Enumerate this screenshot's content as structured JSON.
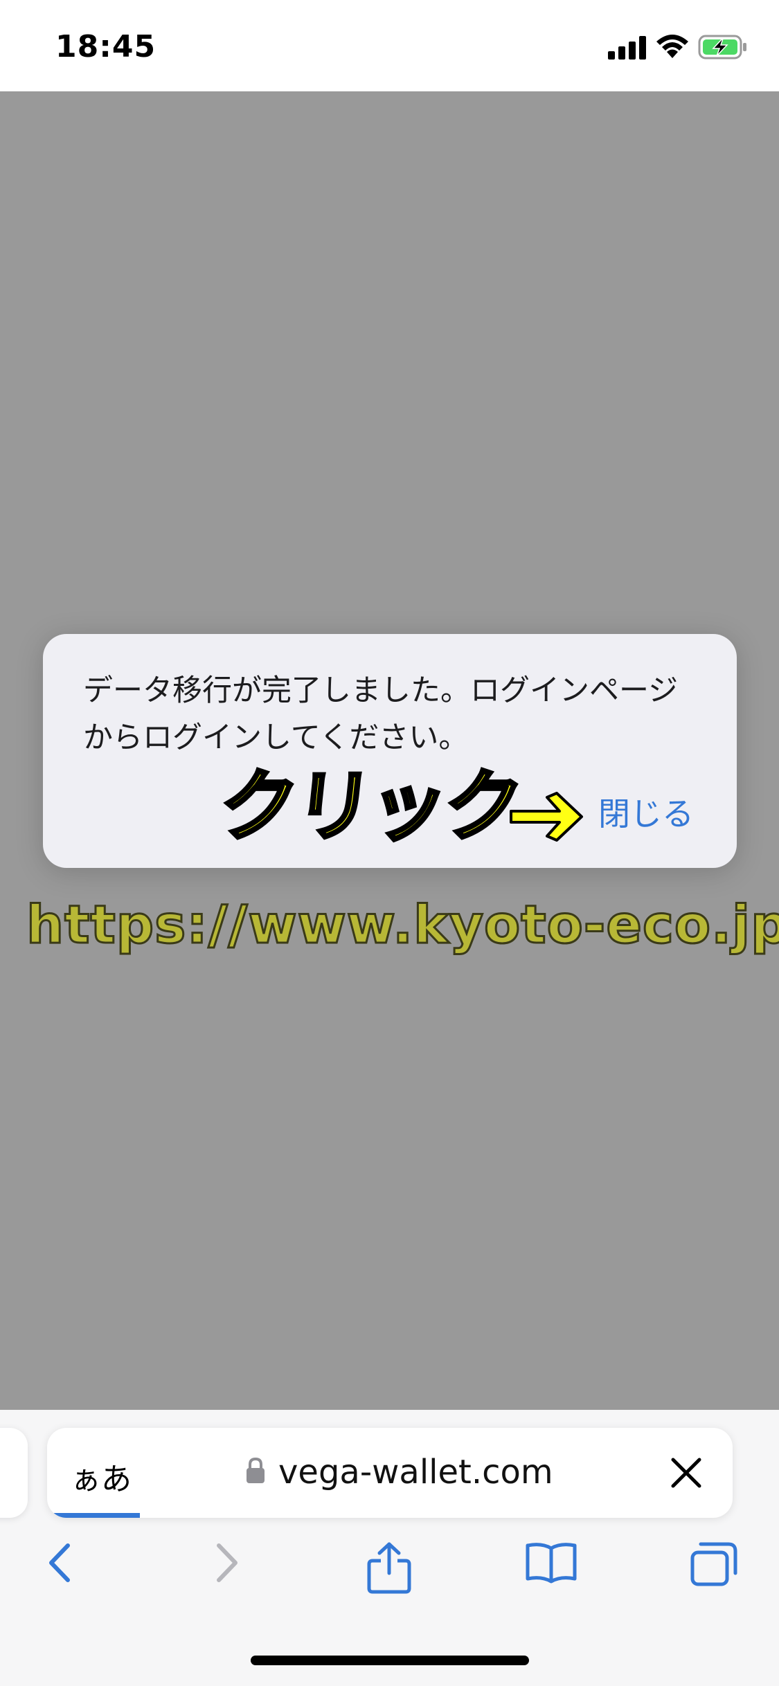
{
  "status_bar": {
    "time": "18:45",
    "signal_icon": "cellular-signal-icon",
    "wifi_icon": "wifi-icon",
    "battery_icon": "battery-charging-icon"
  },
  "dialog": {
    "message": "データ移行が完了しました。ログインページからログインしてください。",
    "close_label": "閉じる"
  },
  "annotation": {
    "click_text": "クリック",
    "arrow_icon": "right-arrow-icon",
    "watermark": "https://www.kyoto-eco.jp/"
  },
  "address_bar": {
    "reader_label": "ぁあ",
    "lock_icon": "lock-icon",
    "url": "vega-wallet.com",
    "stop_icon": "close-icon"
  },
  "toolbar": {
    "back_icon": "chevron-left-icon",
    "forward_icon": "chevron-right-icon",
    "share_icon": "share-icon",
    "bookmarks_icon": "book-icon",
    "tabs_icon": "tabs-icon"
  },
  "colors": {
    "accent": "#3478d6",
    "overlay_background": "#999999",
    "annotation_yellow": "#ffff14"
  }
}
